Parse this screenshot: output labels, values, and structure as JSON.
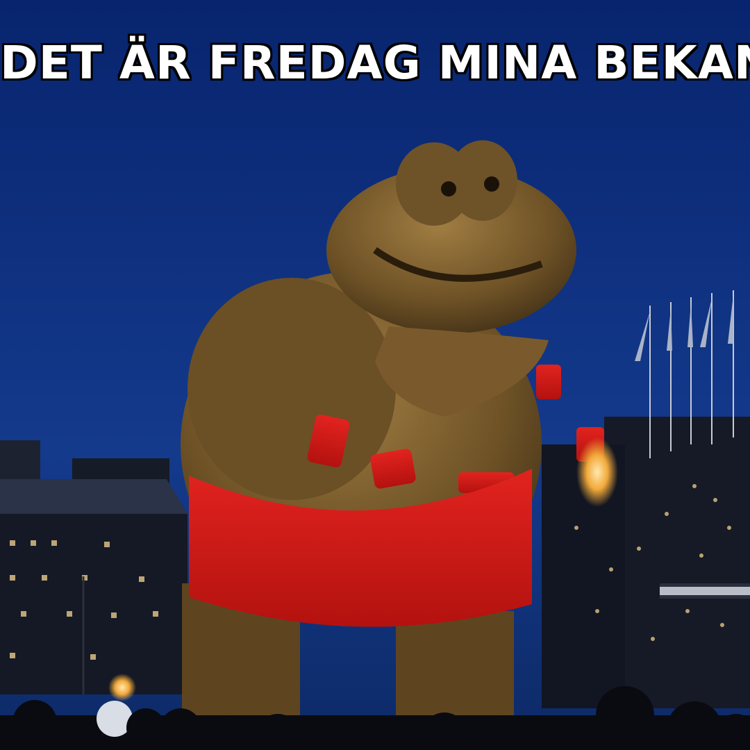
{
  "meme": {
    "caption": "DET ÄR FREDAG MINA BEKANTA"
  },
  "scene": {
    "subject": "giant straw frog figure",
    "colors": {
      "sky_top": "#0a2a78",
      "sky_bottom": "#1b3f8a",
      "straw": "#7a5a2a",
      "straw_highlight": "#b08a48",
      "band_red": "#d81e1e",
      "building": "#1a2030"
    }
  }
}
